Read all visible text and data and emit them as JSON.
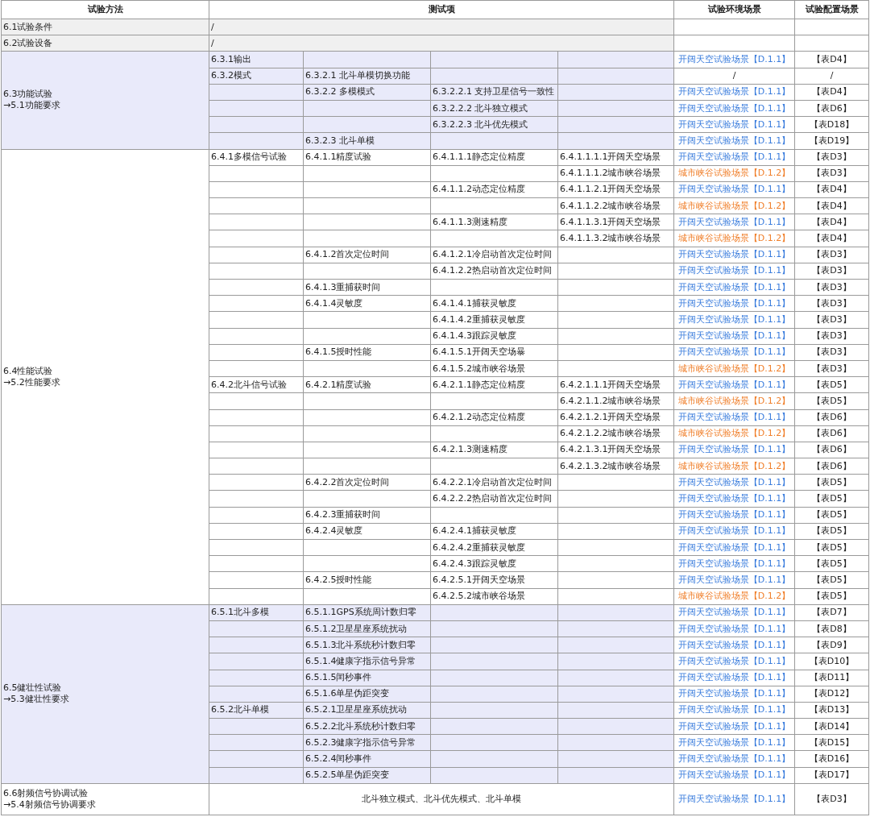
{
  "columns": [
    "试验方法",
    "测试项",
    "试验环境场景",
    "试验配置场景"
  ],
  "groups": [
    {
      "kind": "gray",
      "method": [
        "6.1试验条件"
      ],
      "rows": [
        {
          "merged": "/"
        }
      ]
    },
    {
      "kind": "gray",
      "method": [
        "6.2试验设备"
      ],
      "rows": [
        {
          "merged": "/"
        }
      ]
    },
    {
      "kind": "tinted",
      "method": [
        "6.3功能试验",
        "→5.1功能要求"
      ],
      "rows": [
        {
          "level_1": "6.3.1输出",
          "env": {
            "text": "开阔天空试验场景【D.1.1】",
            "color": "#3b7ddd"
          },
          "config": "【表D4】"
        },
        {
          "level_1": "6.3.2模式",
          "level_2": "6.3.2.1 北斗单模切换功能",
          "env": {
            "text": "/"
          },
          "config": "/"
        },
        {
          "level_2": "6.3.2.2 多模模式",
          "level_3": "6.3.2.2.1 支持卫星信号一致性",
          "env": {
            "text": "开阔天空试验场景【D.1.1】",
            "color": "#3b7ddd"
          },
          "config": "【表D4】"
        },
        {
          "level_3": "6.3.2.2.2 北斗独立模式",
          "env": {
            "text": "开阔天空试验场景【D.1.1】",
            "color": "#3b7ddd"
          },
          "config": "【表D6】"
        },
        {
          "level_3": "6.3.2.2.3 北斗优先模式",
          "env": {
            "text": "开阔天空试验场景【D.1.1】",
            "color": "#3b7ddd"
          },
          "config": "【表D18】"
        },
        {
          "level_2": "6.3.2.3 北斗单模",
          "env": {
            "text": "开阔天空试验场景【D.1.1】",
            "color": "#3b7ddd"
          },
          "config": "【表D19】"
        }
      ]
    },
    {
      "kind": "plain",
      "method": [
        "6.4性能试验",
        "→5.2性能要求"
      ],
      "rows": [
        {
          "level_1": "6.4.1多模信号试验",
          "level_2": "6.4.1.1精度试验",
          "level_3": "6.4.1.1.1静态定位精度",
          "level_4": "6.4.1.1.1.1开阔天空场景",
          "env": {
            "text": "开阔天空试验场景【D.1.1】",
            "color": "#3b7ddd"
          },
          "config": "【表D3】"
        },
        {
          "level_4": "6.4.1.1.1.2城市峡谷场景",
          "env": {
            "text": "城市峡谷试验场景【D.1.2】",
            "color": "#f07f2a"
          },
          "config": "【表D3】"
        },
        {
          "level_3": "6.4.1.1.2动态定位精度",
          "level_4": "6.4.1.1.2.1开阔天空场景",
          "env": {
            "text": "开阔天空试验场景【D.1.1】",
            "color": "#3b7ddd"
          },
          "config": "【表D4】"
        },
        {
          "level_4": "6.4.1.1.2.2城市峡谷场景",
          "env": {
            "text": "城市峡谷试验场景【D.1.2】",
            "color": "#f07f2a"
          },
          "config": "【表D4】"
        },
        {
          "level_3": "6.4.1.1.3测速精度",
          "level_4": "6.4.1.1.3.1开阔天空场景",
          "env": {
            "text": "开阔天空试验场景【D.1.1】",
            "color": "#3b7ddd"
          },
          "config": "【表D4】"
        },
        {
          "level_4": "6.4.1.1.3.2城市峡谷场景",
          "env": {
            "text": "城市峡谷试验场景【D.1.2】",
            "color": "#f07f2a"
          },
          "config": "【表D4】"
        },
        {
          "level_2": "6.4.1.2首次定位时间",
          "level_3": "6.4.1.2.1冷启动首次定位时间",
          "env": {
            "text": "开阔天空试验场景【D.1.1】",
            "color": "#3b7ddd"
          },
          "config": "【表D3】"
        },
        {
          "level_3": "6.4.1.2.2热启动首次定位时间",
          "env": {
            "text": "开阔天空试验场景【D.1.1】",
            "color": "#3b7ddd"
          },
          "config": "【表D3】"
        },
        {
          "level_2": "6.4.1.3重捕获时间",
          "env": {
            "text": "开阔天空试验场景【D.1.1】",
            "color": "#3b7ddd"
          },
          "config": "【表D3】"
        },
        {
          "level_2": "6.4.1.4灵敏度",
          "level_3": "6.4.1.4.1捕获灵敏度",
          "env": {
            "text": "开阔天空试验场景【D.1.1】",
            "color": "#3b7ddd"
          },
          "config": "【表D3】"
        },
        {
          "level_3": "6.4.1.4.2重捕获灵敏度",
          "env": {
            "text": "开阔天空试验场景【D.1.1】",
            "color": "#3b7ddd"
          },
          "config": "【表D3】"
        },
        {
          "level_3": "6.4.1.4.3跟踪灵敏度",
          "env": {
            "text": "开阔天空试验场景【D.1.1】",
            "color": "#3b7ddd"
          },
          "config": "【表D3】"
        },
        {
          "level_2": "6.4.1.5授时性能",
          "level_3": "6.4.1.5.1开阔天空场暴",
          "env": {
            "text": "开阔天空试验场景【D.1.1】",
            "color": "#3b7ddd"
          },
          "config": "【表D3】"
        },
        {
          "level_3": "6.4.1.5.2城市峡谷场景",
          "env": {
            "text": "城市峡谷试验场景【D.1.2】",
            "color": "#f07f2a"
          },
          "config": "【表D3】"
        },
        {
          "level_1": "6.4.2北斗信号试验",
          "level_2": "6.4.2.1精度试验",
          "level_3": "6.4.2.1.1静态定位精度",
          "level_4": "6.4.2.1.1.1开阔天空场景",
          "env": {
            "text": "开阔天空试验场景【D.1.1】",
            "color": "#3b7ddd"
          },
          "config": "【表D5】"
        },
        {
          "level_4": "6.4.2.1.1.2城市峡谷场景",
          "env": {
            "text": "城市峡谷试验场景【D.1.2】",
            "color": "#f07f2a"
          },
          "config": "【表D5】"
        },
        {
          "level_3": "6.4.2.1.2动态定位精度",
          "level_4": "6.4.2.1.2.1开阔天空场景",
          "env": {
            "text": "开阔天空试验场景【D.1.1】",
            "color": "#3b7ddd"
          },
          "config": "【表D6】"
        },
        {
          "level_4": "6.4.2.1.2.2城市峡谷场景",
          "env": {
            "text": "城市峡谷试验场景【D.1.2】",
            "color": "#f07f2a"
          },
          "config": "【表D6】"
        },
        {
          "level_3": "6.4.2.1.3测速精度",
          "level_4": "6.4.2.1.3.1开阔天空场景",
          "env": {
            "text": "开阔天空试验场景【D.1.1】",
            "color": "#3b7ddd"
          },
          "config": "【表D6】"
        },
        {
          "level_4": "6.4.2.1.3.2城市峡谷场景",
          "env": {
            "text": "城市峡谷试验场景【D.1.2】",
            "color": "#f07f2a"
          },
          "config": "【表D6】"
        },
        {
          "level_2": "6.4.2.2首次定位时间",
          "level_3": "6.4.2.2.1冷启动首次定位时间",
          "env": {
            "text": "开阔天空试验场景【D.1.1】",
            "color": "#3b7ddd"
          },
          "config": "【表D5】"
        },
        {
          "level_3": "6.4.2.2.2热启动首次定位时间",
          "env": {
            "text": "开阔天空试验场景【D.1.1】",
            "color": "#3b7ddd"
          },
          "config": "【表D5】"
        },
        {
          "level_2": "6.4.2.3重捕获时间",
          "env": {
            "text": "开阔天空试验场景【D.1.1】",
            "color": "#3b7ddd"
          },
          "config": "【表D5】"
        },
        {
          "level_2": "6.4.2.4灵敏度",
          "level_3": "6.4.2.4.1捕获灵敏度",
          "env": {
            "text": "开阔天空试验场景【D.1.1】",
            "color": "#3b7ddd"
          },
          "config": "【表D5】"
        },
        {
          "level_3": "6.4.2.4.2重捕获灵敏度",
          "env": {
            "text": "开阔天空试验场景【D.1.1】",
            "color": "#3b7ddd"
          },
          "config": "【表D5】"
        },
        {
          "level_3": "6.4.2.4.3跟踪灵敏度",
          "env": {
            "text": "开阔天空试验场景【D.1.1】",
            "color": "#3b7ddd"
          },
          "config": "【表D5】"
        },
        {
          "level_2": "6.4.2.5授时性能",
          "level_3": "6.4.2.5.1开阔天空场景",
          "env": {
            "text": "开阔天空试验场景【D.1.1】",
            "color": "#3b7ddd"
          },
          "config": "【表D5】"
        },
        {
          "level_3": "6.4.2.5.2城市峡谷场景",
          "env": {
            "text": "城市峡谷试验场景【D.1.2】",
            "color": "#f07f2a"
          },
          "config": "【表D5】"
        }
      ]
    },
    {
      "kind": "tinted",
      "method": [
        "6.5健壮性试验",
        "→5.3健壮性要求"
      ],
      "rows": [
        {
          "level_1": "6.5.1北斗多模",
          "level_2": "6.5.1.1GPS系统周计数归零",
          "env": {
            "text": "开阔天空试验场景【D.1.1】",
            "color": "#3b7ddd"
          },
          "config": "【表D7】"
        },
        {
          "level_2": "6.5.1.2卫星星座系统扰动",
          "env": {
            "text": "开阔天空试验场景【D.1.1】",
            "color": "#3b7ddd"
          },
          "config": "【表D8】"
        },
        {
          "level_2": "6.5.1.3北斗系统秒计数归零",
          "env": {
            "text": "开阔天空试验场景【D.1.1】",
            "color": "#3b7ddd"
          },
          "config": "【表D9】"
        },
        {
          "level_2": "6.5.1.4健康字指示信号异常",
          "env": {
            "text": "开阔天空试验场景【D.1.1】",
            "color": "#3b7ddd"
          },
          "config": "【表D10】"
        },
        {
          "level_2": "6.5.1.5闰秒事件",
          "env": {
            "text": "开阔天空试验场景【D.1.1】",
            "color": "#3b7ddd"
          },
          "config": "【表D11】"
        },
        {
          "level_2": "6.5.1.6单星伪距突变",
          "env": {
            "text": "开阔天空试验场景【D.1.1】",
            "color": "#3b7ddd"
          },
          "config": "【表D12】"
        },
        {
          "level_1": "6.5.2北斗单模",
          "level_2": "6.5.2.1卫星星座系统扰动",
          "env": {
            "text": "开阔天空试验场景【D.1.1】",
            "color": "#3b7ddd"
          },
          "config": "【表D13】"
        },
        {
          "level_2": "6.5.2.2北斗系统秒计数归零",
          "env": {
            "text": "开阔天空试验场景【D.1.1】",
            "color": "#3b7ddd"
          },
          "config": "【表D14】"
        },
        {
          "level_2": "6.5.2.3健康字指示信号异常",
          "env": {
            "text": "开阔天空试验场景【D.1.1】",
            "color": "#3b7ddd"
          },
          "config": "【表D15】"
        },
        {
          "level_2": "6.5.2.4闰秒事件",
          "env": {
            "text": "开阔天空试验场景【D.1.1】",
            "color": "#3b7ddd"
          },
          "config": "【表D16】"
        },
        {
          "level_2": "6.5.2.5单星伪距突变",
          "env": {
            "text": "开阔天空试验场景【D.1.1】",
            "color": "#3b7ddd"
          },
          "config": "【表D17】"
        }
      ]
    },
    {
      "kind": "plain",
      "method": [
        "6.6射频信号协调试验",
        "→5.4射频信号协调要求"
      ],
      "rows": [
        {
          "merged": "北斗独立模式、北斗优先模式、北斗单模",
          "env": {
            "text": "开阔天空试验场景【D.1.1】",
            "color": "#3b7ddd"
          },
          "config": "【表D3】"
        }
      ]
    }
  ]
}
